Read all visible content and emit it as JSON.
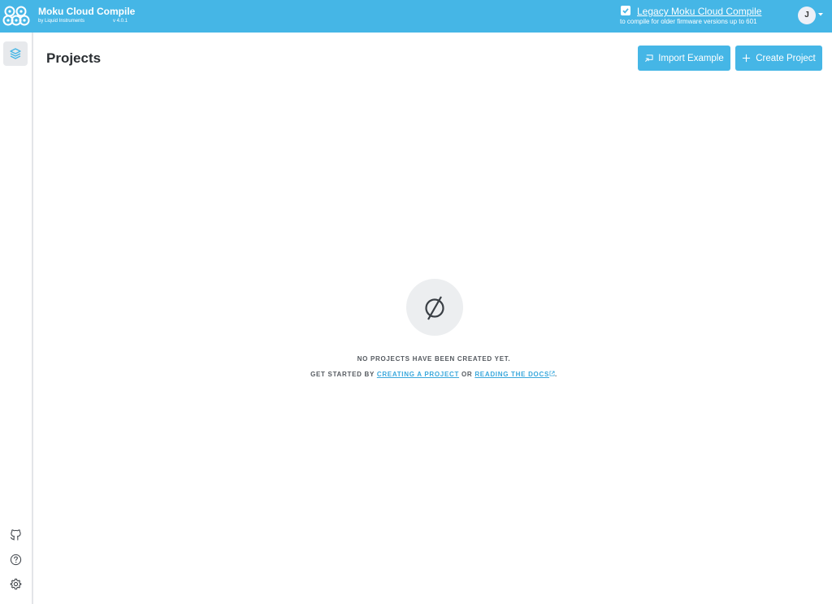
{
  "header": {
    "app_title": "Moku Cloud Compile",
    "app_subtitle": "by Liquid Instruments",
    "version": "v 4.0.1",
    "legacy_link": "Legacy Moku Cloud Compile",
    "legacy_subtext": "to compile for older firmware versions up to 601",
    "legacy_checked": true,
    "user_initial": "J",
    "accent_color": "#45b6e6"
  },
  "sidebar": {
    "items": [
      {
        "name": "projects",
        "icon": "layers-icon",
        "active": true
      },
      {
        "name": "github",
        "icon": "github-icon",
        "active": false
      },
      {
        "name": "help",
        "icon": "help-circle-icon",
        "active": false
      },
      {
        "name": "settings",
        "icon": "gear-icon",
        "active": false
      }
    ]
  },
  "main": {
    "title": "Projects",
    "import_label": "Import Example",
    "create_label": "Create Project",
    "empty_message": "NO PROJECTS HAVE BEEN CREATED YET.",
    "hint_prefix": "GET STARTED BY",
    "hint_link1": "CREATING A PROJECT",
    "hint_or": "OR",
    "hint_link2": "READING THE DOCS",
    "hint_suffix": "."
  }
}
